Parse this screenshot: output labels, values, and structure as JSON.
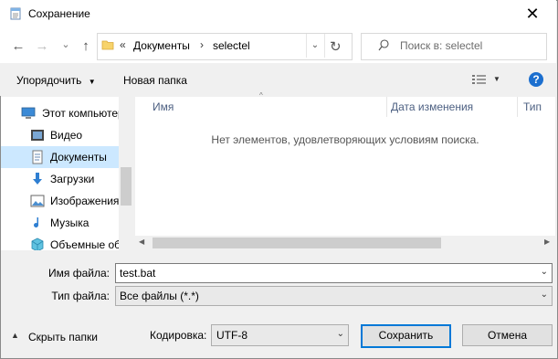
{
  "window": {
    "title": "Сохранение",
    "close_glyph": "✕"
  },
  "nav": {
    "back_glyph": "←",
    "forward_glyph": "→",
    "recent_glyph": "⌄",
    "up_glyph": "↑",
    "breadcrumb_prefix": "«",
    "breadcrumb": [
      "Документы",
      "selectel"
    ],
    "breadcrumb_sep": "›",
    "refresh_glyph": "↻",
    "search_placeholder": "Поиск в: selectel"
  },
  "toolbar": {
    "organize_label": "Упорядочить",
    "new_folder_label": "Новая папка",
    "help_glyph": "?"
  },
  "sidebar": {
    "items": [
      {
        "label": "Этот компьютер",
        "icon": "computer-icon",
        "selected": false
      },
      {
        "label": "Видео",
        "icon": "video-icon",
        "selected": false
      },
      {
        "label": "Документы",
        "icon": "documents-icon",
        "selected": true
      },
      {
        "label": "Загрузки",
        "icon": "downloads-icon",
        "selected": false
      },
      {
        "label": "Изображения",
        "icon": "pictures-icon",
        "selected": false
      },
      {
        "label": "Музыка",
        "icon": "music-icon",
        "selected": false
      },
      {
        "label": "Объемные объекты",
        "icon": "3d-objects-icon",
        "selected": false
      }
    ]
  },
  "filelist": {
    "columns": [
      "Имя",
      "Дата изменения",
      "Тип"
    ],
    "empty_message": "Нет элементов, удовлетворяющих условиям поиска."
  },
  "form": {
    "filename_label": "Имя файла:",
    "filename_value": "test.bat",
    "filetype_label": "Тип файла:",
    "filetype_value": "Все файлы  (*.*)",
    "encoding_label": "Кодировка:",
    "encoding_value": "UTF-8",
    "hide_folders_label": "Скрыть папки",
    "save_label": "Сохранить",
    "cancel_label": "Отмена"
  },
  "colors": {
    "accent": "#0078d7",
    "selection": "#cce8ff",
    "help_blue": "#1c6fcf"
  }
}
